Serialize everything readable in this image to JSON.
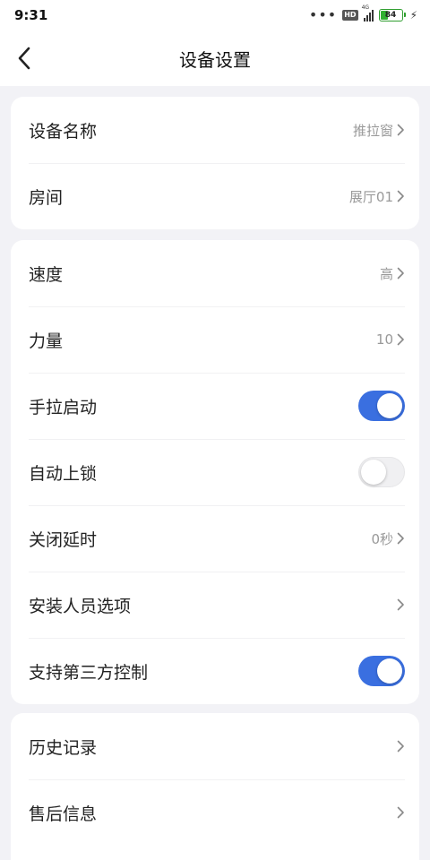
{
  "status_bar": {
    "time": "9:31",
    "network": "4G",
    "hd": "HD",
    "battery": "84",
    "icons": [
      "more-dots-icon",
      "hd-icon",
      "signal-icon",
      "battery-icon",
      "charging-icon"
    ]
  },
  "nav": {
    "title": "设备设置",
    "back_icon": "chevron-left-icon"
  },
  "section1": {
    "items": [
      {
        "label": "设备名称",
        "value": "推拉窗"
      },
      {
        "label": "房间",
        "value": "展厅01"
      }
    ]
  },
  "section2": {
    "speed": {
      "label": "速度",
      "value": "高"
    },
    "force": {
      "label": "力量",
      "value": "10"
    },
    "manual_start": {
      "label": "手拉启动",
      "on": true
    },
    "auto_lock": {
      "label": "自动上锁",
      "on": false
    },
    "close_delay": {
      "label": "关闭延时",
      "value": "0秒"
    },
    "installer": {
      "label": "安装人员选项"
    },
    "third_party": {
      "label": "支持第三方控制",
      "on": true
    }
  },
  "section3": {
    "items": [
      {
        "label": "历史记录"
      },
      {
        "label": "售后信息"
      }
    ]
  },
  "colors": {
    "toggle_on": "#3a6fe0",
    "background": "#f2f2f6",
    "battery": "#31b031"
  }
}
